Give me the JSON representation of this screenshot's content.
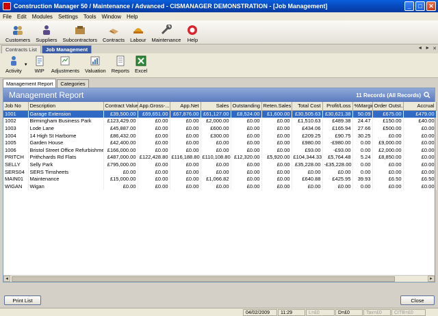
{
  "window": {
    "title": "Construction Manager 50 / Maintenance / Advanced  -  CISMANAGER  DEMONSTRATION - [Job Management]"
  },
  "menu": [
    "File",
    "Edit",
    "Modules",
    "Settings",
    "Tools",
    "Window",
    "Help"
  ],
  "toolbar": [
    {
      "label": "Customers",
      "icon": "customers-icon"
    },
    {
      "label": "Suppliers",
      "icon": "suppliers-icon"
    },
    {
      "label": "Subcontractors",
      "icon": "subcontractors-icon"
    },
    {
      "label": "Contracts",
      "icon": "contracts-icon"
    },
    {
      "label": "Labour",
      "icon": "labour-icon"
    },
    {
      "label": "Maintenance",
      "icon": "maintenance-icon"
    },
    {
      "label": "Help",
      "icon": "help-icon"
    }
  ],
  "doc_tabs": [
    "Contracts List",
    "Job Management"
  ],
  "actions": [
    {
      "label": "Activity",
      "icon": "activity-icon"
    },
    {
      "label": "WIP",
      "icon": "wip-icon"
    },
    {
      "label": "Adjustments",
      "icon": "adjustments-icon"
    },
    {
      "label": "Valuation",
      "icon": "valuation-icon"
    },
    {
      "label": "Reports",
      "icon": "reports-icon"
    },
    {
      "label": "Excel",
      "icon": "excel-icon"
    }
  ],
  "sub_tabs": [
    "Management Report",
    "Categories"
  ],
  "report": {
    "title": "Management Report",
    "count": "11 Records (All Records)"
  },
  "columns": [
    "Job No",
    "Description",
    "Contract Value",
    "App.Gross-...",
    "App.Net",
    "Sales",
    "Outstanding",
    "Reten.Sales",
    "Total Cost",
    "Profit/Loss",
    "%Margin",
    "Order Outst...",
    "Accrual"
  ],
  "rows": [
    [
      "1001",
      "Garage Extension",
      "£39,500.00",
      "£69,651.00",
      "£67,876.00",
      "£61,127.00",
      "£8,524.00",
      "£1,600.00",
      "£30,505.63",
      "£30,621.38",
      "50.09",
      "£675.00",
      "£479.00"
    ],
    [
      "1002",
      "Birmingham Business Park",
      "£123,429.00",
      "£0.00",
      "£0.00",
      "£2,000.00",
      "£0.00",
      "£0.00",
      "£1,510.63",
      "£489.38",
      "24.47",
      "£150.00",
      "£40.00"
    ],
    [
      "1003",
      "Lode Lane",
      "£45,887.00",
      "£0.00",
      "£0.00",
      "£600.00",
      "£0.00",
      "£0.00",
      "£434.06",
      "£165.94",
      "27.66",
      "£500.00",
      "£0.00"
    ],
    [
      "1004",
      "14 High St Harbome",
      "£86,432.00",
      "£0.00",
      "£0.00",
      "£300.00",
      "£0.00",
      "£0.00",
      "£209.25",
      "£90.75",
      "30.25",
      "£0.00",
      "£0.00"
    ],
    [
      "1005",
      "Garden House",
      "£42,400.00",
      "£0.00",
      "£0.00",
      "£0.00",
      "£0.00",
      "£0.00",
      "£980.00",
      "-£980.00",
      "0.00",
      "£9,000.00",
      "£0.00"
    ],
    [
      "1006",
      "Bristol Street Office Refurbishment",
      "£166,000.00",
      "£0.00",
      "£0.00",
      "£0.00",
      "£0.00",
      "£0.00",
      "£93.00",
      "-£93.00",
      "0.00",
      "£2,000.00",
      "£0.00"
    ],
    [
      "PRITCH",
      "Prithchards Rd Flats",
      "£487,000.00",
      "£122,428.80",
      "£116,188.80",
      "£110,108.80",
      "£12,320.00",
      "£5,920.00",
      "£104,344.33",
      "£5,764.48",
      "5.24",
      "£8,850.00",
      "£0.00"
    ],
    [
      "SELLY",
      "Selly Park",
      "£795,000.00",
      "£0.00",
      "£0.00",
      "£0.00",
      "£0.00",
      "£0.00",
      "£35,228.00",
      "-£35,228.00",
      "0.00",
      "£0.00",
      "£0.00"
    ],
    [
      "SERS04",
      "SERS Timsheets",
      "£0.00",
      "£0.00",
      "£0.00",
      "£0.00",
      "£0.00",
      "£0.00",
      "£0.00",
      "£0.00",
      "0.00",
      "£0.00",
      "£0.00"
    ],
    [
      "MAIN01",
      "Maintenance",
      "£15,000.00",
      "£0.00",
      "£0.00",
      "£1,066.82",
      "£0.00",
      "£0.00",
      "£640.88",
      "£425.95",
      "39.93",
      "£6.50",
      "£6.50"
    ],
    [
      "WIGAN",
      "Wigan",
      "£0.00",
      "£0.00",
      "£0.00",
      "£0.00",
      "£0.00",
      "£0.00",
      "£0.00",
      "£0.00",
      "0.00",
      "£0.00",
      "£0.00"
    ]
  ],
  "buttons": {
    "print": "Print List",
    "close": "Close"
  },
  "status": {
    "date": "04/02/2009",
    "time": "11:29",
    "l": "L=£0",
    "d": "D=£0",
    "tax": "Tax=£0",
    "citb": "CITB=£0"
  }
}
